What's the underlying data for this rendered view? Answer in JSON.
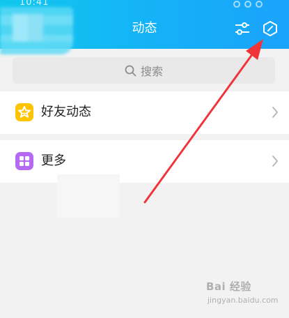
{
  "status_bar": {
    "time_fragment": "10:41"
  },
  "header": {
    "title": "动态",
    "bg_start": "#0fc8ee",
    "bg_end": "#1aa3fb"
  },
  "search": {
    "placeholder": "搜索"
  },
  "rows": [
    {
      "label": "好友动态",
      "icon": "star-icon",
      "color": "#ffc400"
    },
    {
      "label": "更多",
      "icon": "grid-icon",
      "color": "#b46bf2"
    }
  ],
  "watermark": {
    "logo": "Bai 经验",
    "sub": "jingyan.baidu.com"
  },
  "annotation": {
    "arrow_color": "#f0353a"
  }
}
